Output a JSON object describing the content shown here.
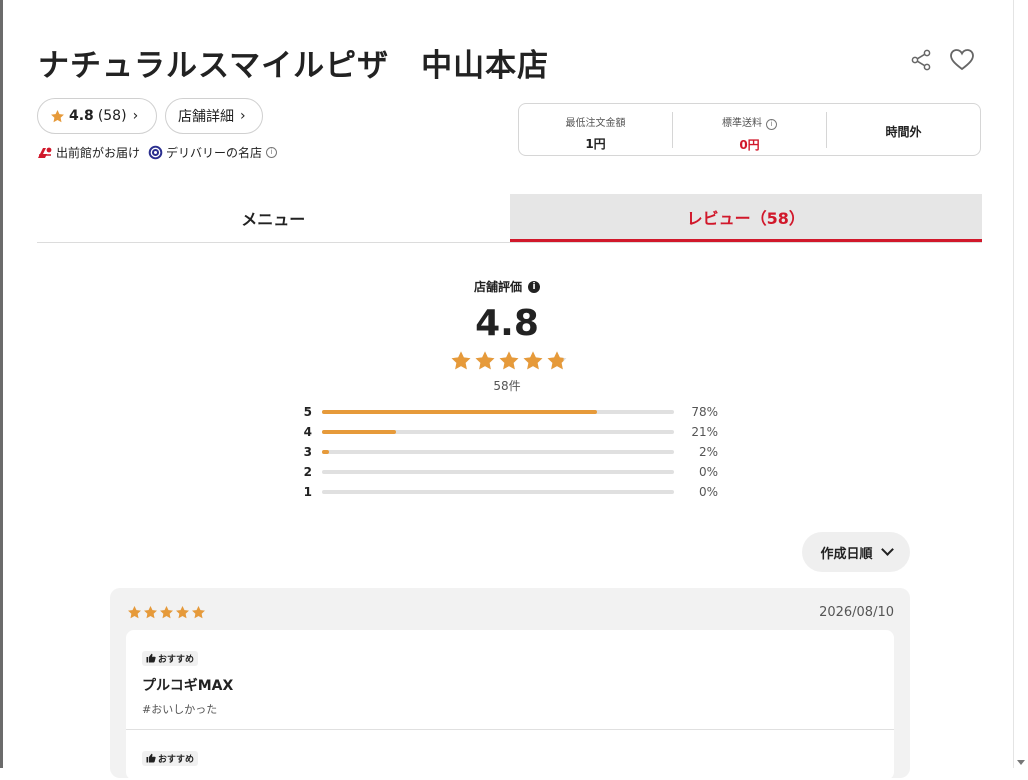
{
  "store": {
    "name": "ナチュラルスマイルピザ　中山本店",
    "rating": "4.8",
    "rating_count": "(58)",
    "detail_label": "店舗詳細",
    "badge1": "出前館がお届け",
    "badge2": "デリバリーの名店"
  },
  "delivery_info": {
    "min_order_label": "最低注文金額",
    "min_order_value": "1円",
    "fee_label": "標準送料",
    "fee_value": "0円",
    "time_value": "時間外"
  },
  "tabs": [
    {
      "label": "メニュー",
      "active": false
    },
    {
      "label": "レビュー（58）",
      "active": true
    }
  ],
  "summary": {
    "label": "店舗評価",
    "score": "4.8",
    "stars": 4.8,
    "count": "58件",
    "distribution": [
      {
        "star": "5",
        "fraction": 0.78,
        "pct": "78%"
      },
      {
        "star": "4",
        "fraction": 0.21,
        "pct": "21%"
      },
      {
        "star": "3",
        "fraction": 0.02,
        "pct": "2%"
      },
      {
        "star": "2",
        "fraction": 0.0,
        "pct": "0%"
      },
      {
        "star": "1",
        "fraction": 0.0,
        "pct": "0%"
      }
    ]
  },
  "sort": {
    "label": "作成日順"
  },
  "reviews": [
    {
      "stars": 5,
      "date": "2026/08/10",
      "items": [
        {
          "tag": "おすすめ",
          "name": "プルコギMAX",
          "hashtag": "#おいしかった"
        },
        {
          "tag": "おすすめ",
          "name": "",
          "hashtag": ""
        }
      ]
    }
  ],
  "colors": {
    "accent": "#d1182b",
    "star": "#e69a3a",
    "bar_track": "#e0e0e0"
  },
  "icons": [
    "share-icon",
    "heart-icon",
    "star-icon",
    "chevron-right-icon",
    "demaekan-logo-icon",
    "meiten-badge-icon",
    "info-icon",
    "chevron-down-icon",
    "thumbs-up-icon"
  ]
}
